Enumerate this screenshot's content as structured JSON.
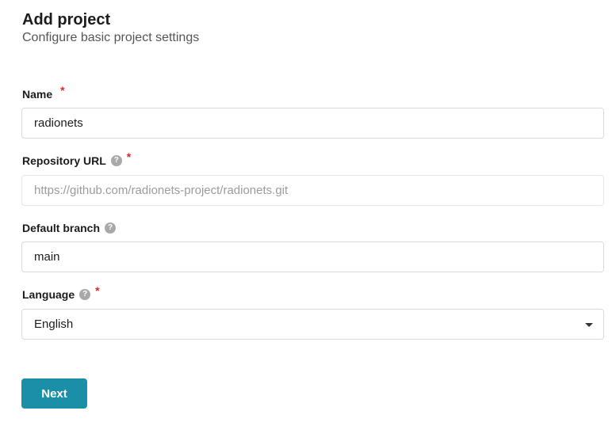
{
  "header": {
    "title": "Add project",
    "subtitle": "Configure basic project settings"
  },
  "form": {
    "name": {
      "label": "Name",
      "required_mark": "*",
      "value": "radionets"
    },
    "repository_url": {
      "label": "Repository URL",
      "help_glyph": "?",
      "required_mark": "*",
      "placeholder": "https://github.com/radionets-project/radionets.git"
    },
    "default_branch": {
      "label": "Default branch",
      "help_glyph": "?",
      "value": "main"
    },
    "language": {
      "label": "Language",
      "help_glyph": "?",
      "required_mark": "*",
      "selected": "English"
    }
  },
  "actions": {
    "next_label": "Next"
  },
  "colors": {
    "primary_button": "#1b8fa8",
    "required": "#db2828",
    "help_icon": "#a8a8a8"
  }
}
